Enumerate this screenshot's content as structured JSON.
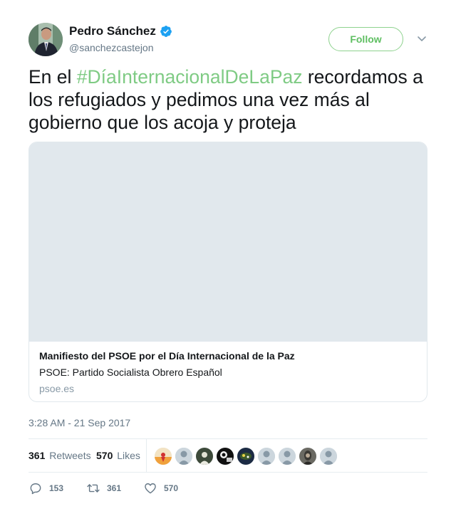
{
  "author": {
    "name": "Pedro Sánchez",
    "handle": "@sanchezcastejon",
    "verified": true
  },
  "follow_label": "Follow",
  "tweet": {
    "text_before": "En el ",
    "hashtag": "#DíaInternacionalDeLaPaz",
    "text_after": " recordamos a los refugiados y pedimos una vez más al gobierno que los acoja y proteja"
  },
  "card": {
    "title": "Manifiesto del PSOE por el Día Internacional de la Paz",
    "description": "PSOE: Partido Socialista Obrero Español",
    "domain": "psoe.es"
  },
  "timestamp": "3:28 AM - 21 Sep 2017",
  "stats": {
    "retweets_count": "361",
    "retweets_label": "Retweets",
    "likes_count": "570",
    "likes_label": "Likes"
  },
  "actions": {
    "replies": "153",
    "retweets": "361",
    "likes": "570"
  },
  "icons": {
    "verified": "verified-badge-icon",
    "caret": "chevron-down-icon",
    "reply": "reply-icon",
    "retweet": "retweet-icon",
    "like": "heart-icon"
  },
  "colors": {
    "hashtag": "#7fcb84",
    "follow_border": "#8ed28e",
    "verified": "#1da1f2",
    "secondary_text": "#657786"
  }
}
